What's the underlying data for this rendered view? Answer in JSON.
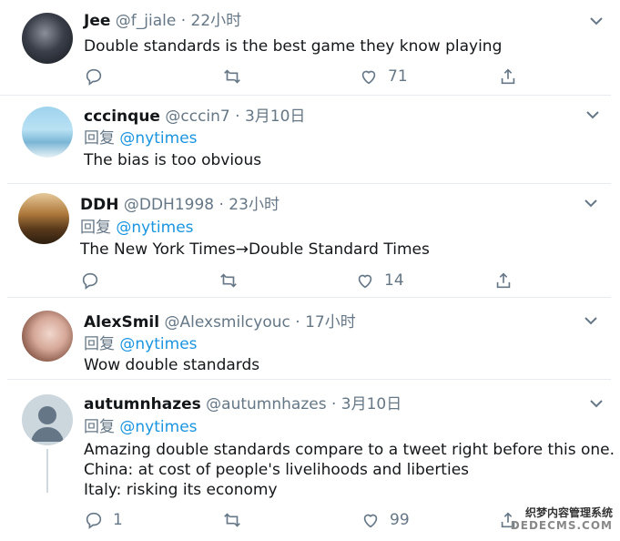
{
  "tweets": [
    {
      "name": "Jee",
      "handle": "@f_jiale",
      "time": "· 22小时",
      "text": "Double standards is the best game they know playing",
      "reply_counts": {
        "reply": "",
        "like": "71"
      }
    },
    {
      "name": "cccinque",
      "handle": "@cccin7",
      "time": "· 3月10日",
      "reply_prefix": "回复",
      "reply_to": "@nytimes",
      "text": "The bias is too obvious"
    },
    {
      "name": "DDH",
      "handle": "@DDH1998",
      "time": "· 23小时",
      "reply_prefix": "回复",
      "reply_to": "@nytimes",
      "text": "The New York Times→Double Standard Times",
      "reply_counts": {
        "reply": "",
        "like": "14"
      }
    },
    {
      "name": "AlexSmil",
      "handle": "@Alexsmilcyouc",
      "time": "· 17小时",
      "reply_prefix": "回复",
      "reply_to": "@nytimes",
      "text": "Wow double standards"
    },
    {
      "name": "autumnhazes",
      "handle": "@autumnhazes",
      "time": "· 3月10日",
      "reply_prefix": "回复",
      "reply_to": "@nytimes",
      "lines": [
        "Amazing double standards compare to a tweet right before this one.",
        "China: at cost of people's livelihoods and liberties",
        "Italy: risking its economy"
      ],
      "reply_counts": {
        "reply": "1",
        "like": "99"
      }
    }
  ],
  "watermark": {
    "line1": "织梦内容管理系统",
    "line2": "DEDECMS.COM"
  },
  "colors": {
    "link": "#1b95e0",
    "muted": "#657786",
    "separator": "#e6ecf0"
  }
}
